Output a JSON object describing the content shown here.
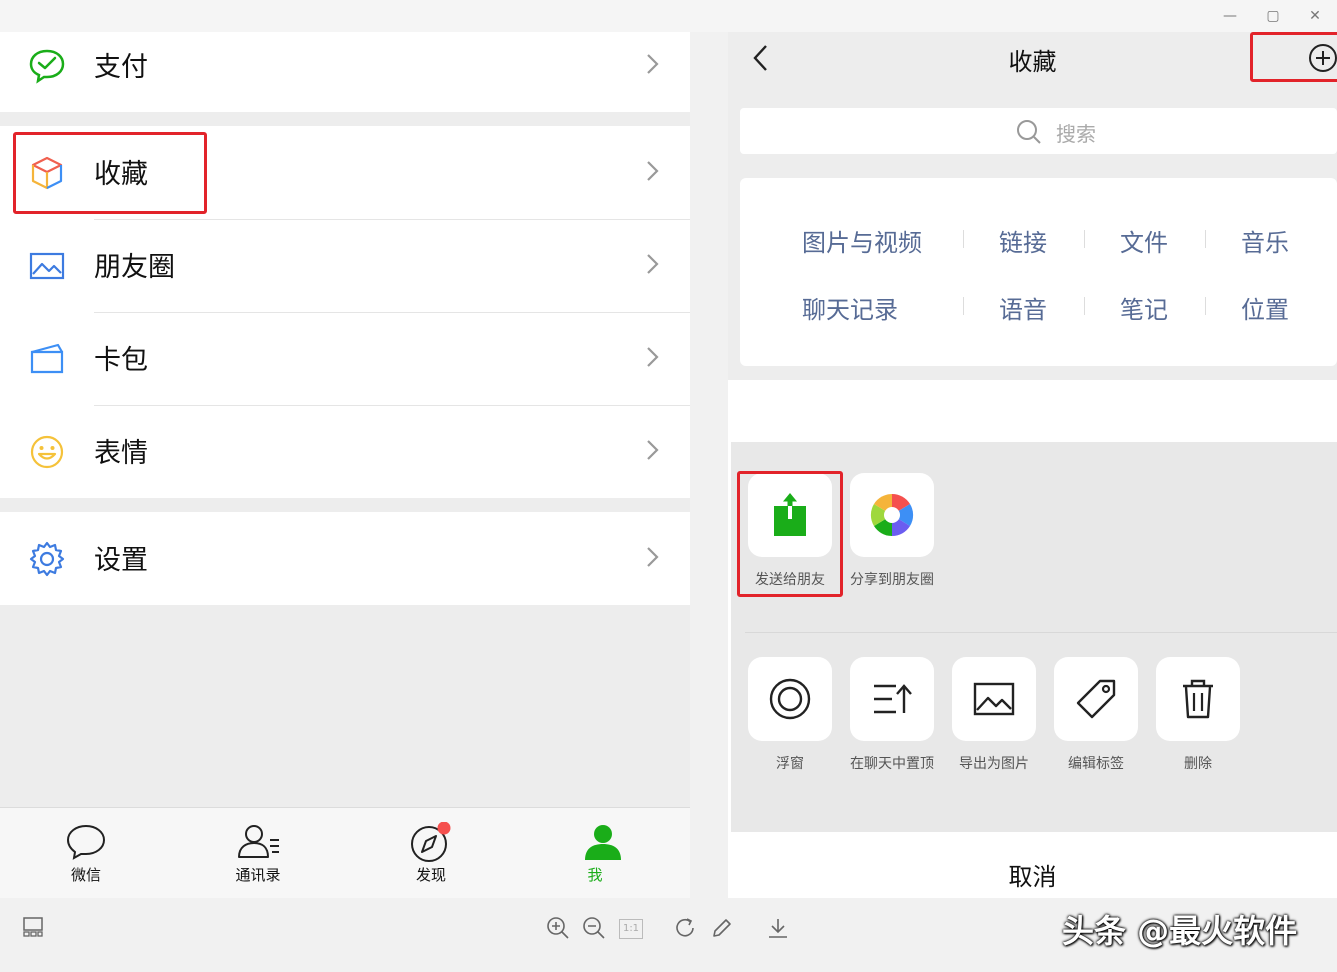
{
  "menu": {
    "items": [
      {
        "label": "支付",
        "icon": "pay-icon"
      },
      {
        "label": "收藏",
        "icon": "favorites-cube-icon"
      },
      {
        "label": "朋友圈",
        "icon": "moments-picture-icon"
      },
      {
        "label": "卡包",
        "icon": "cards-icon"
      },
      {
        "label": "表情",
        "icon": "sticker-smile-icon"
      },
      {
        "label": "设置",
        "icon": "settings-gear-icon"
      }
    ]
  },
  "tabbar": {
    "tabs": [
      {
        "label": "微信",
        "icon": "chat-bubble-icon"
      },
      {
        "label": "通讯录",
        "icon": "contacts-icon"
      },
      {
        "label": "发现",
        "icon": "compass-icon"
      },
      {
        "label": "我",
        "icon": "person-icon",
        "active": true
      }
    ]
  },
  "favorites": {
    "title": "收藏",
    "search_placeholder": "搜索",
    "categories": [
      "图片与视频",
      "链接",
      "文件",
      "音乐",
      "聊天记录",
      "语音",
      "笔记",
      "位置"
    ]
  },
  "share_sheet": {
    "share_actions": [
      {
        "label": "发送给朋友",
        "icon": "send-to-friend-icon"
      },
      {
        "label": "分享到朋友圈",
        "icon": "share-to-moments-icon"
      }
    ],
    "more_actions": [
      {
        "label": "浮窗",
        "icon": "floating-window-icon"
      },
      {
        "label": "在聊天中置顶",
        "icon": "pin-to-top-icon"
      },
      {
        "label": "导出为图片",
        "icon": "export-image-icon"
      },
      {
        "label": "编辑标签",
        "icon": "tag-icon"
      },
      {
        "label": "删除",
        "icon": "trash-icon"
      }
    ],
    "cancel_label": "取消"
  },
  "viewer_toolbar": {
    "ratio_label": "1:1"
  },
  "watermark": "头条 @最火软件",
  "colors": {
    "wechat_green": "#1aad19",
    "link_blue": "#576b95",
    "highlight_red": "#e2232a",
    "badge_red": "#f5504e"
  }
}
